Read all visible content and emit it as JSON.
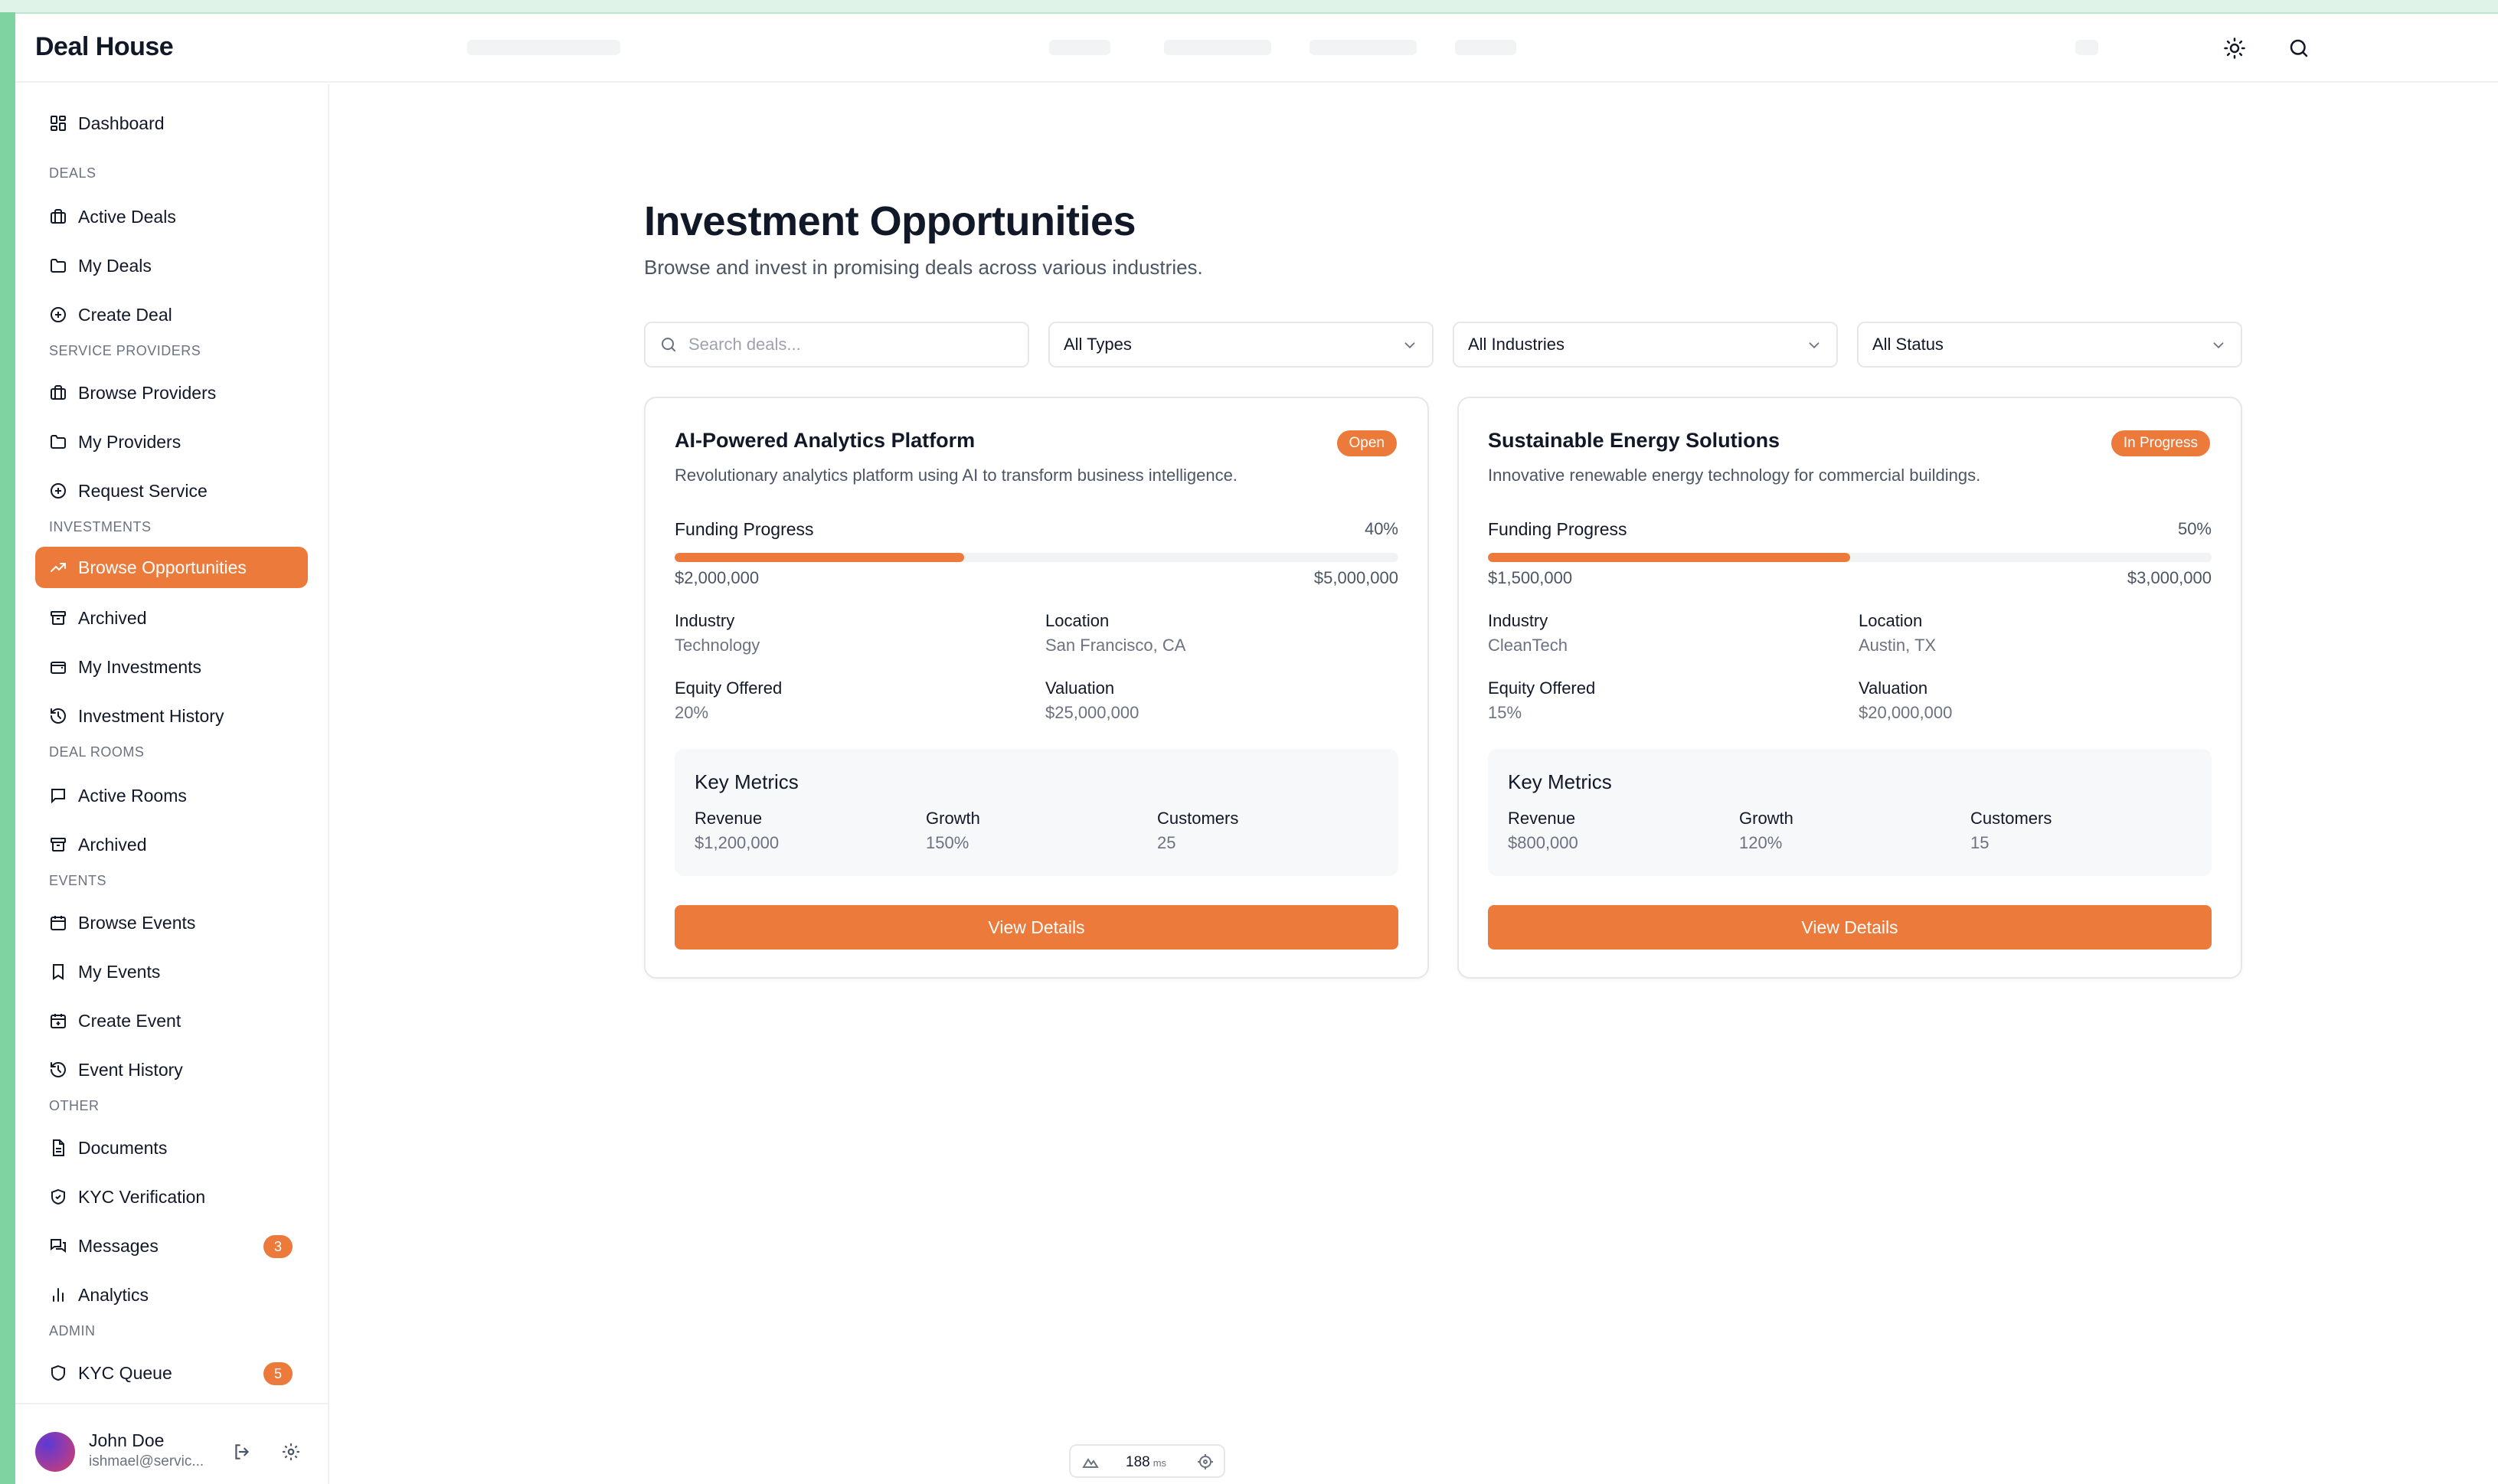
{
  "app": {
    "brand": "Deal House"
  },
  "header": {
    "theme_icon": "sun-icon",
    "search_icon": "search-icon"
  },
  "sidebar": {
    "dashboard": "Dashboard",
    "sections": {
      "deals": "DEALS",
      "service_providers": "SERVICE PROVIDERS",
      "investments": "INVESTMENTS",
      "deal_rooms": "DEAL ROOMS",
      "events": "EVENTS",
      "other": "OTHER",
      "admin": "ADMIN"
    },
    "items": {
      "active_deals": "Active Deals",
      "my_deals": "My Deals",
      "create_deal": "Create Deal",
      "browse_providers": "Browse Providers",
      "my_providers": "My Providers",
      "request_service": "Request Service",
      "browse_opportunities": "Browse Opportunities",
      "archived_investments": "Archived",
      "my_investments": "My Investments",
      "investment_history": "Investment History",
      "active_rooms": "Active Rooms",
      "archived_rooms": "Archived",
      "browse_events": "Browse Events",
      "my_events": "My Events",
      "create_event": "Create Event",
      "event_history": "Event History",
      "documents": "Documents",
      "kyc_verification": "KYC Verification",
      "messages": "Messages",
      "analytics": "Analytics",
      "kyc_queue": "KYC Queue"
    },
    "badges": {
      "messages": "3",
      "kyc_queue": "5"
    },
    "user": {
      "name": "John Doe",
      "email": "ishmael@servic..."
    }
  },
  "main": {
    "title": "Investment Opportunities",
    "subtitle": "Browse and invest in promising deals across various industries.",
    "search_placeholder": "Search deals...",
    "filters": {
      "type": "All Types",
      "industry": "All Industries",
      "status": "All Status"
    }
  },
  "labels": {
    "funding_progress": "Funding Progress",
    "industry": "Industry",
    "location": "Location",
    "equity": "Equity Offered",
    "valuation": "Valuation",
    "key_metrics": "Key Metrics",
    "revenue": "Revenue",
    "growth": "Growth",
    "customers": "Customers",
    "view_details": "View Details"
  },
  "deals": [
    {
      "title": "AI-Powered Analytics Platform",
      "status": "Open",
      "description": "Revolutionary analytics platform using AI to transform business intelligence.",
      "progress_label": "40%",
      "progress": 0.4,
      "raised": "$2,000,000",
      "goal": "$5,000,000",
      "industry": "Technology",
      "location": "San Francisco, CA",
      "equity": "20%",
      "valuation": "$25,000,000",
      "revenue": "$1,200,000",
      "growth": "150%",
      "customers": "25"
    },
    {
      "title": "Sustainable Energy Solutions",
      "status": "In Progress",
      "description": "Innovative renewable energy technology for commercial buildings.",
      "progress_label": "50%",
      "progress": 0.5,
      "raised": "$1,500,000",
      "goal": "$3,000,000",
      "industry": "CleanTech",
      "location": "Austin, TX",
      "equity": "15%",
      "valuation": "$20,000,000",
      "revenue": "$800,000",
      "growth": "120%",
      "customers": "15"
    }
  ],
  "dev_widget": {
    "ms": "188",
    "unit": "ms"
  },
  "colors": {
    "accent": "#ec7a3a",
    "border": "#e5e7eb",
    "muted": "#6b7280"
  }
}
